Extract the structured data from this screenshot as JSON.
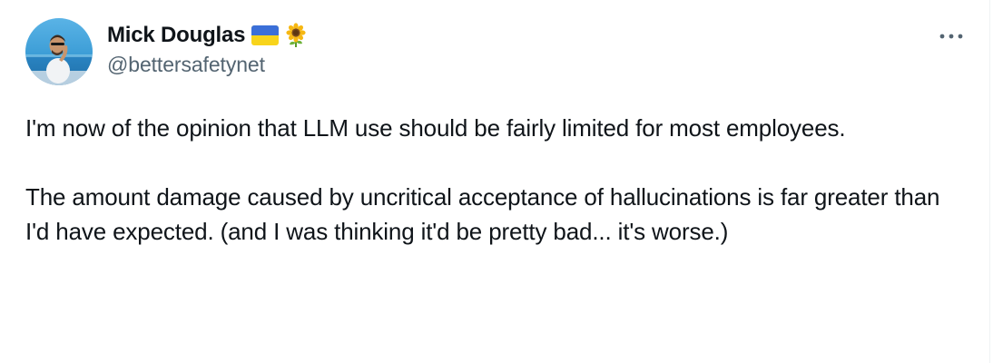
{
  "author": {
    "display_name": "Mick Douglas",
    "handle": "@bettersafetynet",
    "name_emojis": [
      "ukraine-flag-icon",
      "sunflower-icon"
    ]
  },
  "menu": {
    "more_icon": "more-horizontal-icon"
  },
  "tweet": {
    "paragraphs": [
      "I'm now of the opinion that LLM use should be fairly limited for most employees.",
      "The amount damage caused by uncritical acceptance of hallucinations is far greater than I'd have expected. (and I was thinking it'd be pretty bad... it's worse.)"
    ]
  },
  "colors": {
    "text_primary": "#0f1419",
    "text_secondary": "#536471",
    "flag_blue": "#3b6fd8",
    "flag_yellow": "#f8d41b"
  }
}
